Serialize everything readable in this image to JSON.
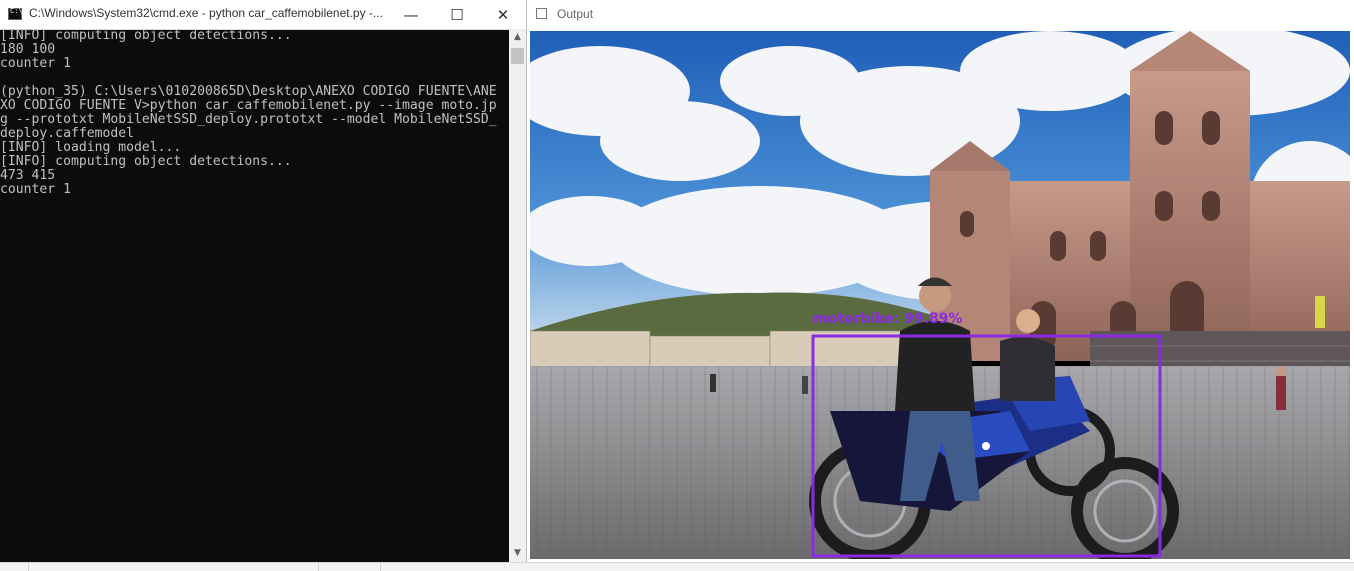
{
  "cmd": {
    "title": "C:\\Windows\\System32\\cmd.exe - python  car_caffemobilenet.py -...",
    "minimize_glyph": "—",
    "maximize_glyph": "☐",
    "close_glyph": "✕",
    "lines": [
      "[INFO] computing object detections...",
      "180 100",
      "counter 1",
      "",
      "(python_35) C:\\Users\\010200865D\\Desktop\\ANEXO CODIGO FUENTE\\ANE",
      "XO CODIGO FUENTE V>python car_caffemobilenet.py --image moto.jp",
      "g --prototxt MobileNetSSD_deploy.prototxt --model MobileNetSSD_",
      "deploy.caffemodel",
      "[INFO] loading model...",
      "[INFO] computing object detections...",
      "473 415",
      "counter 1"
    ],
    "scroll_up_glyph": "▲",
    "scroll_down_glyph": "▼"
  },
  "output": {
    "title": "Output",
    "detection_label": "motorbike: 99.89%",
    "detection_color": "#8a2be2"
  }
}
